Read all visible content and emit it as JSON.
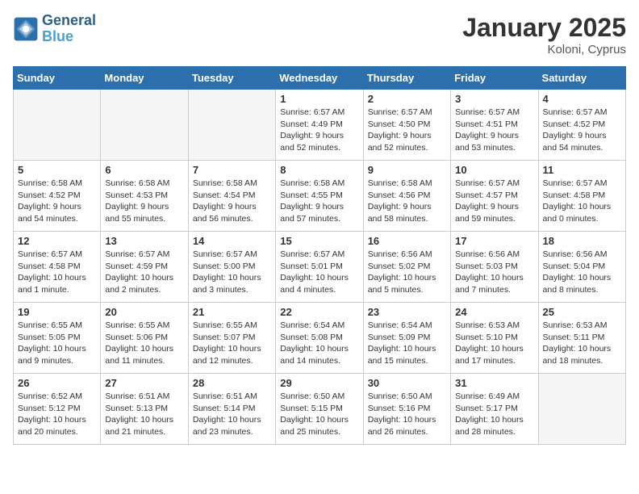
{
  "header": {
    "logo_general": "General",
    "logo_blue": "Blue",
    "month_title": "January 2025",
    "location": "Koloni, Cyprus"
  },
  "days_of_week": [
    "Sunday",
    "Monday",
    "Tuesday",
    "Wednesday",
    "Thursday",
    "Friday",
    "Saturday"
  ],
  "weeks": [
    [
      {
        "day": "",
        "info": ""
      },
      {
        "day": "",
        "info": ""
      },
      {
        "day": "",
        "info": ""
      },
      {
        "day": "1",
        "info": "Sunrise: 6:57 AM\nSunset: 4:49 PM\nDaylight: 9 hours and 52 minutes."
      },
      {
        "day": "2",
        "info": "Sunrise: 6:57 AM\nSunset: 4:50 PM\nDaylight: 9 hours and 52 minutes."
      },
      {
        "day": "3",
        "info": "Sunrise: 6:57 AM\nSunset: 4:51 PM\nDaylight: 9 hours and 53 minutes."
      },
      {
        "day": "4",
        "info": "Sunrise: 6:57 AM\nSunset: 4:52 PM\nDaylight: 9 hours and 54 minutes."
      }
    ],
    [
      {
        "day": "5",
        "info": "Sunrise: 6:58 AM\nSunset: 4:52 PM\nDaylight: 9 hours and 54 minutes."
      },
      {
        "day": "6",
        "info": "Sunrise: 6:58 AM\nSunset: 4:53 PM\nDaylight: 9 hours and 55 minutes."
      },
      {
        "day": "7",
        "info": "Sunrise: 6:58 AM\nSunset: 4:54 PM\nDaylight: 9 hours and 56 minutes."
      },
      {
        "day": "8",
        "info": "Sunrise: 6:58 AM\nSunset: 4:55 PM\nDaylight: 9 hours and 57 minutes."
      },
      {
        "day": "9",
        "info": "Sunrise: 6:58 AM\nSunset: 4:56 PM\nDaylight: 9 hours and 58 minutes."
      },
      {
        "day": "10",
        "info": "Sunrise: 6:57 AM\nSunset: 4:57 PM\nDaylight: 9 hours and 59 minutes."
      },
      {
        "day": "11",
        "info": "Sunrise: 6:57 AM\nSunset: 4:58 PM\nDaylight: 10 hours and 0 minutes."
      }
    ],
    [
      {
        "day": "12",
        "info": "Sunrise: 6:57 AM\nSunset: 4:58 PM\nDaylight: 10 hours and 1 minute."
      },
      {
        "day": "13",
        "info": "Sunrise: 6:57 AM\nSunset: 4:59 PM\nDaylight: 10 hours and 2 minutes."
      },
      {
        "day": "14",
        "info": "Sunrise: 6:57 AM\nSunset: 5:00 PM\nDaylight: 10 hours and 3 minutes."
      },
      {
        "day": "15",
        "info": "Sunrise: 6:57 AM\nSunset: 5:01 PM\nDaylight: 10 hours and 4 minutes."
      },
      {
        "day": "16",
        "info": "Sunrise: 6:56 AM\nSunset: 5:02 PM\nDaylight: 10 hours and 5 minutes."
      },
      {
        "day": "17",
        "info": "Sunrise: 6:56 AM\nSunset: 5:03 PM\nDaylight: 10 hours and 7 minutes."
      },
      {
        "day": "18",
        "info": "Sunrise: 6:56 AM\nSunset: 5:04 PM\nDaylight: 10 hours and 8 minutes."
      }
    ],
    [
      {
        "day": "19",
        "info": "Sunrise: 6:55 AM\nSunset: 5:05 PM\nDaylight: 10 hours and 9 minutes."
      },
      {
        "day": "20",
        "info": "Sunrise: 6:55 AM\nSunset: 5:06 PM\nDaylight: 10 hours and 11 minutes."
      },
      {
        "day": "21",
        "info": "Sunrise: 6:55 AM\nSunset: 5:07 PM\nDaylight: 10 hours and 12 minutes."
      },
      {
        "day": "22",
        "info": "Sunrise: 6:54 AM\nSunset: 5:08 PM\nDaylight: 10 hours and 14 minutes."
      },
      {
        "day": "23",
        "info": "Sunrise: 6:54 AM\nSunset: 5:09 PM\nDaylight: 10 hours and 15 minutes."
      },
      {
        "day": "24",
        "info": "Sunrise: 6:53 AM\nSunset: 5:10 PM\nDaylight: 10 hours and 17 minutes."
      },
      {
        "day": "25",
        "info": "Sunrise: 6:53 AM\nSunset: 5:11 PM\nDaylight: 10 hours and 18 minutes."
      }
    ],
    [
      {
        "day": "26",
        "info": "Sunrise: 6:52 AM\nSunset: 5:12 PM\nDaylight: 10 hours and 20 minutes."
      },
      {
        "day": "27",
        "info": "Sunrise: 6:51 AM\nSunset: 5:13 PM\nDaylight: 10 hours and 21 minutes."
      },
      {
        "day": "28",
        "info": "Sunrise: 6:51 AM\nSunset: 5:14 PM\nDaylight: 10 hours and 23 minutes."
      },
      {
        "day": "29",
        "info": "Sunrise: 6:50 AM\nSunset: 5:15 PM\nDaylight: 10 hours and 25 minutes."
      },
      {
        "day": "30",
        "info": "Sunrise: 6:50 AM\nSunset: 5:16 PM\nDaylight: 10 hours and 26 minutes."
      },
      {
        "day": "31",
        "info": "Sunrise: 6:49 AM\nSunset: 5:17 PM\nDaylight: 10 hours and 28 minutes."
      },
      {
        "day": "",
        "info": ""
      }
    ]
  ]
}
